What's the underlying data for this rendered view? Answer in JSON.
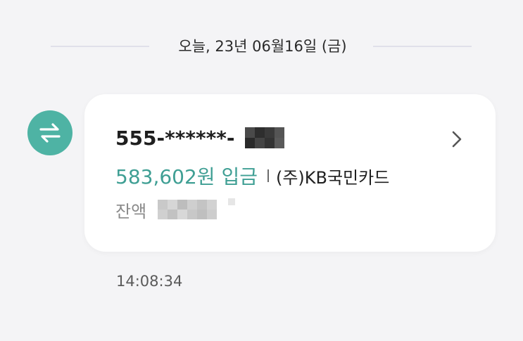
{
  "date_divider": {
    "text": "오늘, 23년 06월16일 (금)"
  },
  "transaction": {
    "icon": "transfer-arrows-icon",
    "account_number": "555-******-",
    "amount_text": "583,602원 입금",
    "merchant": "(주)KB국민카드",
    "balance_label": "잔액",
    "time": "14:08:34"
  },
  "colors": {
    "accent": "#4eb3a4",
    "amount": "#3f9f94",
    "background": "#f4f4f6",
    "card": "#ffffff"
  }
}
